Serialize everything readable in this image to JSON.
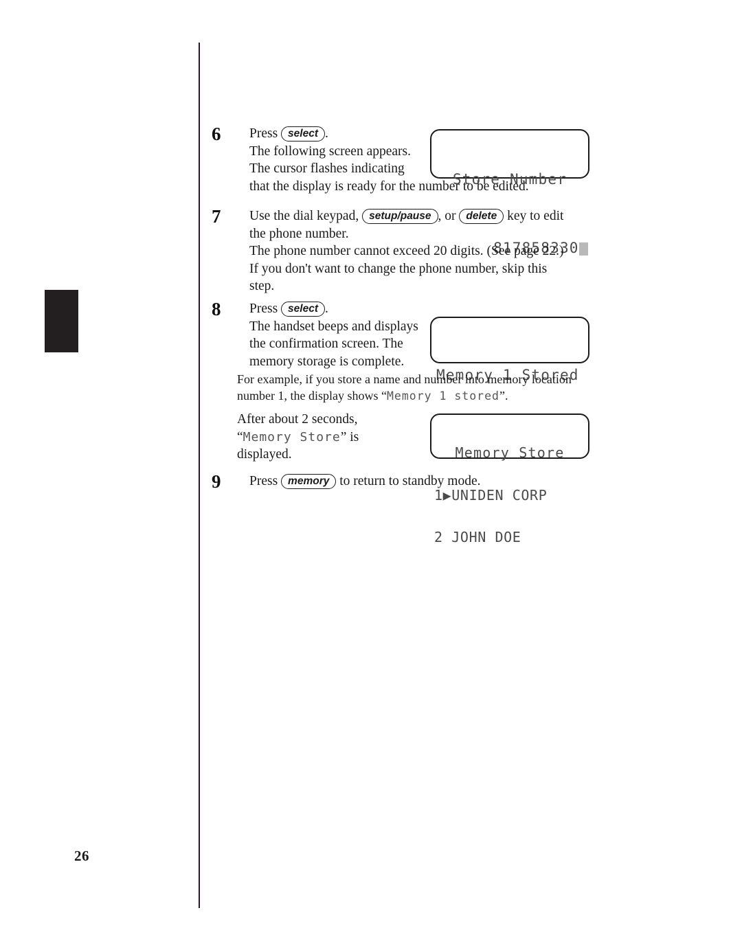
{
  "page": {
    "number": "26"
  },
  "steps": [
    {
      "num": "6",
      "line1_pre": "Press ",
      "key": "select",
      "line1_post": ".",
      "line2": "The following screen appears.",
      "line3": "The cursor flashes indicating",
      "line4": "that the display is ready for the number to be edited."
    },
    {
      "num": "7",
      "line1_pre": "Use the dial keypad, ",
      "key1": "setup/pause",
      "line1_mid": ", or ",
      "key2": "delete",
      "line1_post": " key to edit",
      "line2": "the phone number.",
      "line3": "The phone number cannot exceed 20 digits. (See page 22.)",
      "line4": "If you don't want to change the phone number, skip this",
      "line5": "step."
    },
    {
      "num": "8",
      "line1_pre": "Press ",
      "key": "select",
      "line1_post": ".",
      "line2": "The handset beeps and displays",
      "line3": "the confirmation screen. The",
      "line4": "memory storage is complete."
    },
    {
      "num": "9",
      "line1_pre": "Press ",
      "key": "memory",
      "line1_post": " to return to standby mode."
    }
  ],
  "example_note": {
    "line1": "For example, if you store a name and number into memory location",
    "line2_pre": "number 1, the display shows “",
    "line2_lcd": "Memory 1 stored",
    "line2_post": "”."
  },
  "after_note": {
    "line1": "After about 2 seconds,",
    "line2_open": "“",
    "line2_lcd": "Memory Store",
    "line2_close": "” is",
    "line3": "displayed."
  },
  "lcd_screens": {
    "store_number": {
      "line1": "Store Number",
      "line2": "817858330"
    },
    "memory_stored": {
      "line1": "Memory 1 Stored"
    },
    "memory_store_list": {
      "line1": "Memory Store",
      "line2": "1▶UNIDEN CORP",
      "line3": "2 JOHN DOE"
    }
  }
}
